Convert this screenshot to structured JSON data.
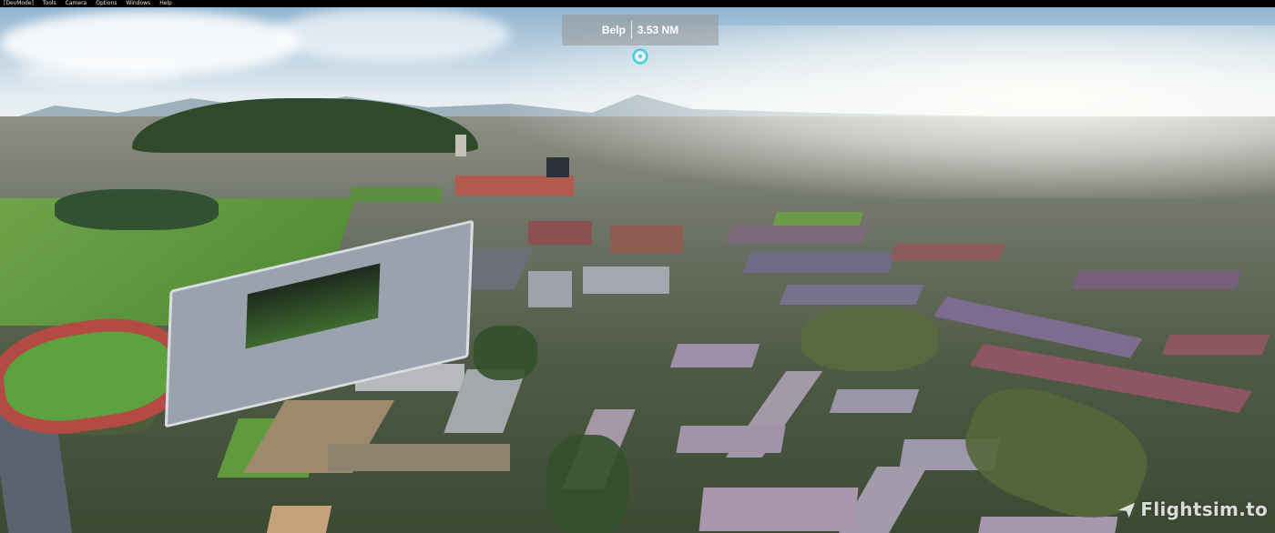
{
  "menu": {
    "items": [
      {
        "label": "[DevMode]"
      },
      {
        "label": "Tools"
      },
      {
        "label": "Camera"
      },
      {
        "label": "Options"
      },
      {
        "label": "Windows"
      },
      {
        "label": "Help"
      }
    ]
  },
  "hud": {
    "waypoint_name": "Belp",
    "distance": "3.53 NM",
    "marker_icon": "waypoint-marker-icon",
    "marker_color": "#2bd3d6"
  },
  "watermark": {
    "icon": "plane-logo-icon",
    "text": "Flightsim.to"
  }
}
